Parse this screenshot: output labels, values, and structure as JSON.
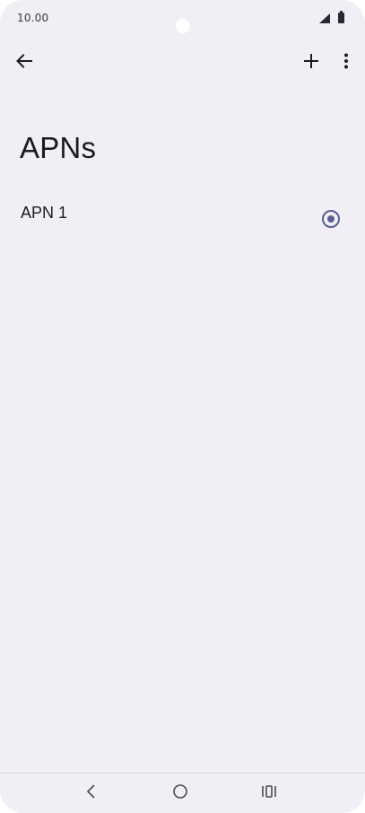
{
  "status_bar": {
    "time": "10.00",
    "icons": [
      "signal-icon",
      "battery-icon"
    ]
  },
  "app_bar": {
    "back_icon": "arrow-left-icon",
    "add_icon": "plus-icon",
    "more_icon": "more-vertical-icon"
  },
  "page": {
    "title": "APNs"
  },
  "apn_list": [
    {
      "name": "APN 1",
      "selected": true
    }
  ],
  "nav_bar": {
    "icons": [
      "back-chevron-icon",
      "home-circle-icon",
      "recents-icon"
    ]
  },
  "colors": {
    "background": "#f1eef5",
    "text": "#1d1b20",
    "accent": "#5a5f95"
  }
}
